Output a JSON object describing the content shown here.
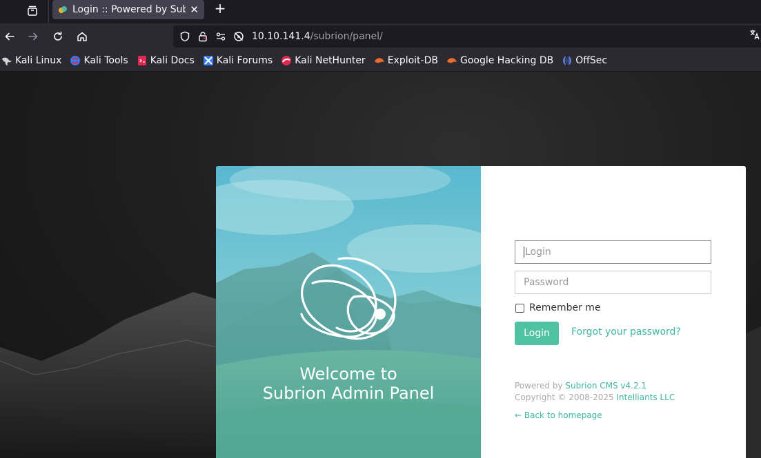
{
  "browser": {
    "tab_title": "Login :: Powered by Subr",
    "tab_close": "✕",
    "new_tab": "+",
    "url_host": "10.10.141.4",
    "url_path": "/subrion/panel/",
    "bookmarks": [
      {
        "label": "Kali Linux",
        "icon": "kali-dragon-icon"
      },
      {
        "label": "Kali Tools",
        "icon": "kali-tools-icon"
      },
      {
        "label": "Kali Docs",
        "icon": "kali-docs-icon"
      },
      {
        "label": "Kali Forums",
        "icon": "kali-forums-icon"
      },
      {
        "label": "Kali NetHunter",
        "icon": "kali-nethunter-icon"
      },
      {
        "label": "Exploit-DB",
        "icon": "exploit-db-icon"
      },
      {
        "label": "Google Hacking DB",
        "icon": "ghdb-icon"
      },
      {
        "label": "OffSec",
        "icon": "offsec-icon"
      }
    ]
  },
  "panel": {
    "welcome_line1": "Welcome to",
    "welcome_line2": "Subrion Admin Panel",
    "login_placeholder": "Login",
    "password_placeholder": "Password",
    "remember_label": "Remember me",
    "login_button": "Login",
    "forgot_link": "Forgot your password?",
    "powered_prefix": "Powered by ",
    "powered_link": "Subrion CMS v4.2.1",
    "copyright_prefix": "Copyright © 2008-2025 ",
    "copyright_link": "Intelliants LLC",
    "back_link": "← Back to homepage"
  },
  "colors": {
    "accent": "#4fc2a3",
    "link": "#3fb6a0",
    "browser_bg": "#1c1b22",
    "toolbar_bg": "#2b2a33"
  }
}
